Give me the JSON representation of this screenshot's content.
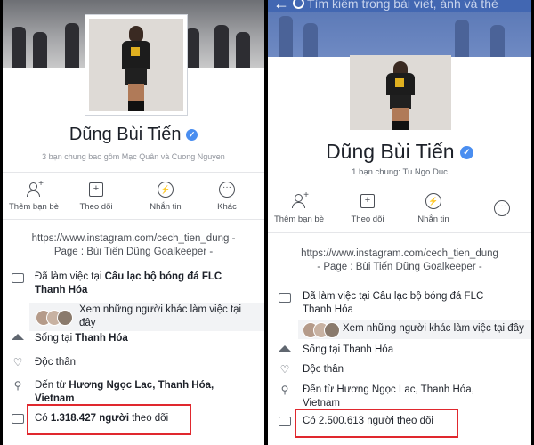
{
  "left": {
    "name": "Dũng Bùi Tiến",
    "mutual": "3 bạn chung bao gồm Mạc Quân và Cuong Nguyen",
    "actions": [
      {
        "icon": "add-friend-icon",
        "label": "Thêm bạn bè"
      },
      {
        "icon": "follow-icon",
        "label": "Theo dõi"
      },
      {
        "icon": "messenger-icon",
        "label": "Nhắn tin"
      },
      {
        "icon": "more-icon",
        "label": "Khác"
      }
    ],
    "link_line1": "https://www.instagram.com/cech_tien_dung -",
    "link_line2": "Page : Bùi Tiến Dũng Goalkeeper -",
    "work_prefix": "Đã làm việc tại ",
    "work_place_line1": "Câu lạc bộ bóng đá FLC",
    "work_place_line2": "Thanh Hóa",
    "see_coworkers_line1": "Xem những người khác làm việc tại",
    "see_coworkers_line2": "đây",
    "lives_prefix": "Sống tại ",
    "lives_place": "Thanh Hóa",
    "relationship": "Độc thân",
    "from_prefix": "Đến từ ",
    "from_place_line1": "Hương Ngọc Lac, Thanh Hóa,",
    "from_place_line2": "Vietnam",
    "followers_prefix": "Có ",
    "followers_count": "1.318.427 người",
    "followers_suffix": " theo dõi"
  },
  "right": {
    "search_placeholder": "Tìm kiếm trong bài viết, ảnh và thẻ",
    "name": "Dũng Bùi Tiến",
    "mutual": "1 bạn chung: Tu Ngo Duc",
    "actions": [
      {
        "icon": "add-friend-icon",
        "label": "Thêm bạn bè"
      },
      {
        "icon": "follow-icon",
        "label": "Theo dõi"
      },
      {
        "icon": "messenger-icon",
        "label": "Nhắn tin"
      },
      {
        "icon": "more-icon",
        "label": ""
      }
    ],
    "link_line1": "https://www.instagram.com/cech_tien_dung",
    "link_line2": "- Page : Bùi Tiến Dũng Goalkeeper -",
    "work_prefix": "Đã làm việc tại ",
    "work_place_line1": "Câu lạc bộ bóng đá FLC",
    "work_place_line2": "Thanh Hóa",
    "see_coworkers": "Xem những người khác làm việc tại đây",
    "lives_prefix": "Sống tại ",
    "lives_place": "Thanh Hóa",
    "relationship": "Độc thân",
    "from_prefix": "Đến từ ",
    "from_place_line1": "Hương Ngọc Lac, Thanh Hóa,",
    "from_place_line2": "Vietnam",
    "followers_prefix": "Có ",
    "followers_count": "2.500.613 người",
    "followers_suffix": " theo dõi"
  },
  "colors": {
    "facebook_blue": "#4267b2",
    "verified_badge": "#4a8ef0",
    "highlight_box": "#e0282e"
  }
}
